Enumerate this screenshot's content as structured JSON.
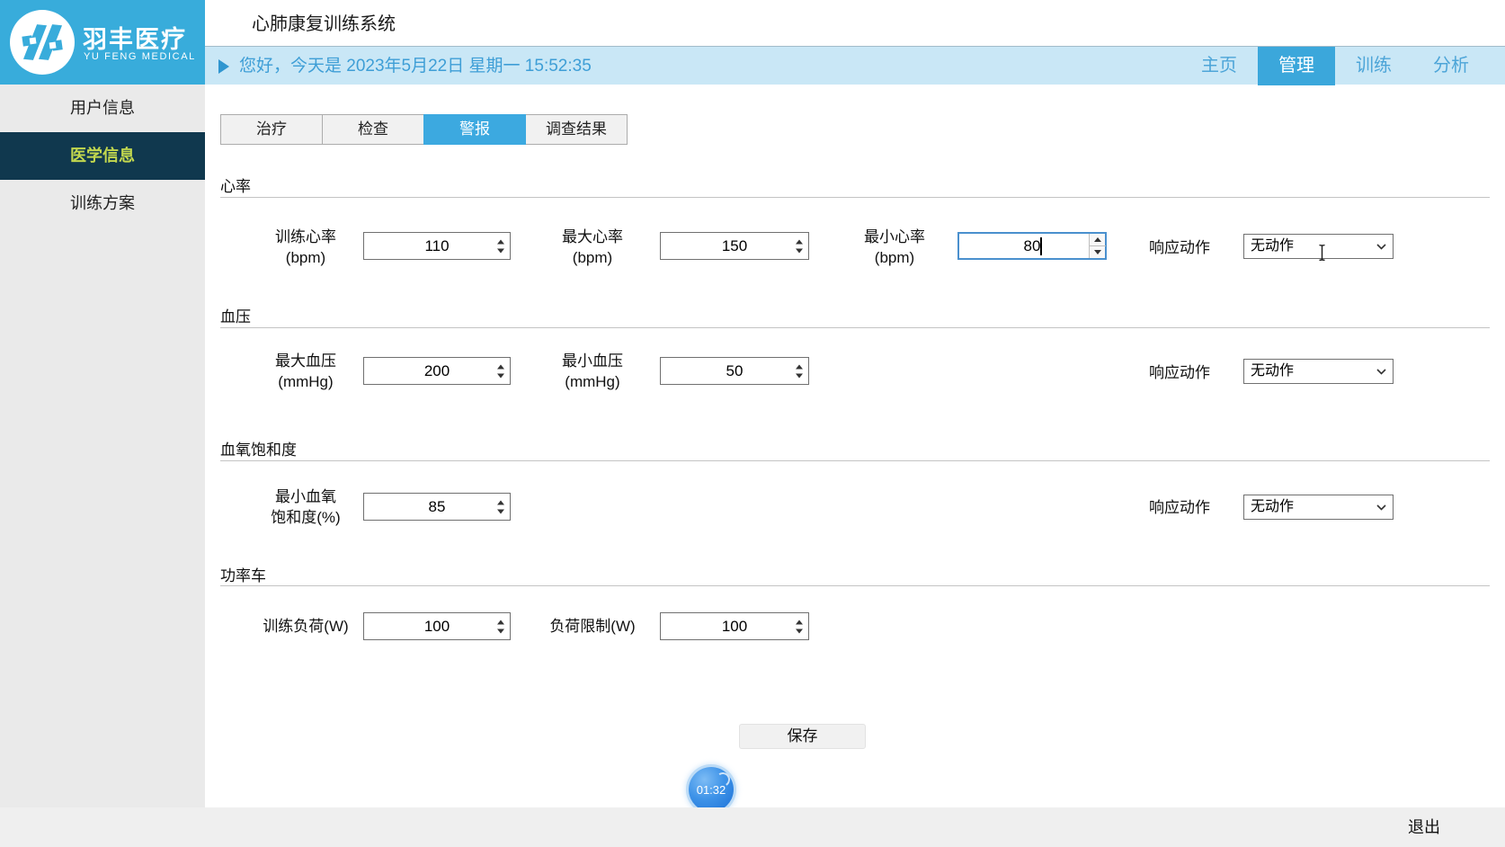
{
  "window": {
    "title": "心肺康复训练系统"
  },
  "brand": {
    "cn": "羽丰医疗",
    "en": "YU FENG MEDICAL"
  },
  "greeting": {
    "text": "您好，今天是 2023年5月22日 星期一 15:52:35"
  },
  "nav": {
    "home": "主页",
    "manage": "管理",
    "train": "训练",
    "analyze": "分析",
    "active": "管理"
  },
  "sidebar": {
    "user_info": "用户信息",
    "medical_info": "医学信息",
    "training_plan": "训练方案",
    "active": "医学信息"
  },
  "tabs": {
    "treatment": "治疗",
    "exam": "检查",
    "alarm": "警报",
    "survey": "调查结果",
    "active": "警报"
  },
  "alarm_form": {
    "heart_rate": {
      "title": "心率",
      "training": {
        "label": "训练心率",
        "unit": "(bpm)",
        "value": "110"
      },
      "max": {
        "label": "最大心率",
        "unit": "(bpm)",
        "value": "150"
      },
      "min": {
        "label": "最小心率",
        "unit": "(bpm)",
        "value": "80",
        "focused": true
      },
      "action_label": "响应动作",
      "action_value": "无动作"
    },
    "blood_pressure": {
      "title": "血压",
      "max": {
        "label": "最大血压",
        "unit": "(mmHg)",
        "value": "200"
      },
      "min": {
        "label": "最小血压",
        "unit": "(mmHg)",
        "value": "50"
      },
      "action_label": "响应动作",
      "action_value": "无动作"
    },
    "spo2": {
      "title": "血氧饱和度",
      "min": {
        "label": "最小血氧",
        "unit": "饱和度(%)",
        "value": "85"
      },
      "action_label": "响应动作",
      "action_value": "无动作"
    },
    "bike": {
      "title": "功率车",
      "load": {
        "label": "训练负荷(W)",
        "value": "100"
      },
      "limit": {
        "label": "负荷限制(W)",
        "value": "100"
      }
    }
  },
  "save_label": "保存",
  "timer": {
    "value": "01:32"
  },
  "footer": {
    "exit": "退出"
  },
  "colors": {
    "accent_blue": "#3ca9e0",
    "header_cyan": "#38acdb",
    "greeting_bg": "#c9e7f6",
    "greeting_text": "#3e9ed6",
    "sidebar_bg": "#eaeaea",
    "sidebar_active_bg": "#10384e",
    "sidebar_active_text": "#c3d84e",
    "focus_border": "#4a90ce",
    "timer_blue": "#2e86e0"
  }
}
